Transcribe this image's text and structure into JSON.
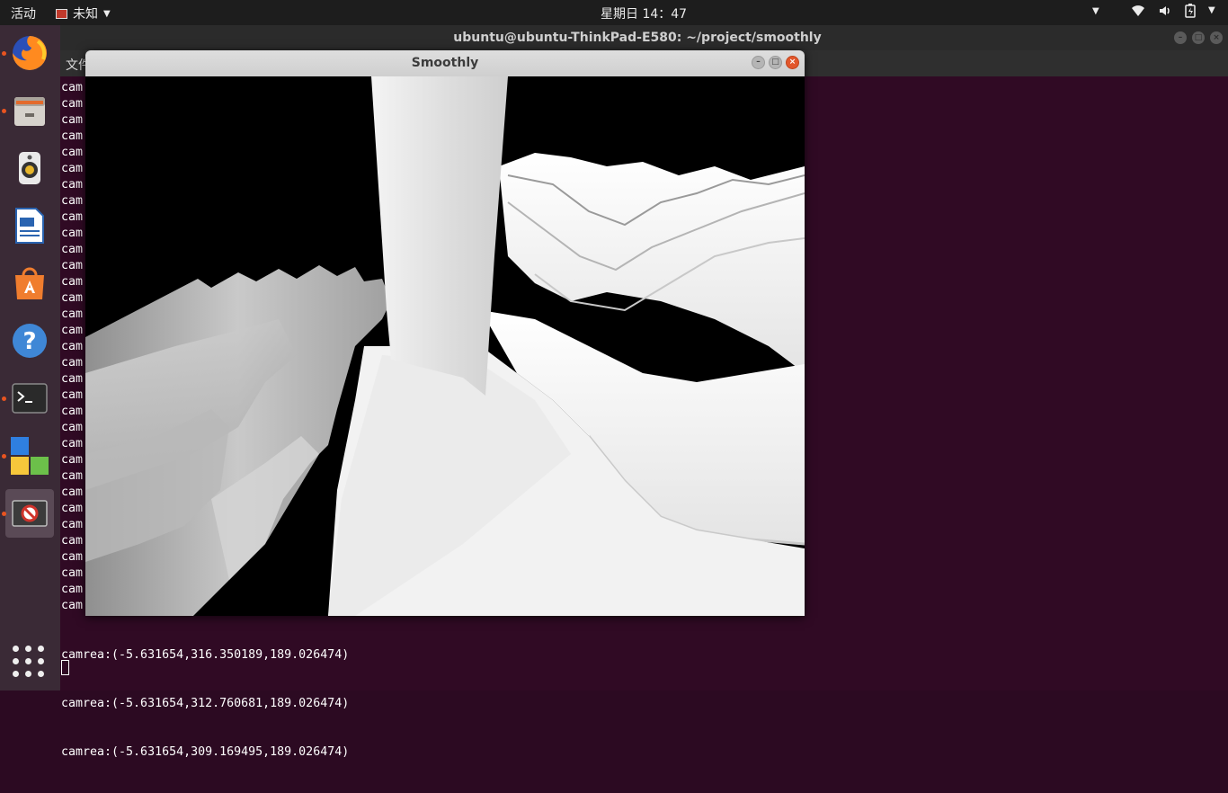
{
  "topbar": {
    "activities": "活动",
    "app_menu": "未知",
    "clock": "星期日 14：47",
    "tray_icons": [
      "wifi-icon",
      "volume-icon",
      "battery-icon",
      "chevron-down-icon"
    ]
  },
  "terminal": {
    "title": "ubuntu@ubuntu-ThinkPad-E580: ~/project/smoothly",
    "menu_first": "文件",
    "partial_prefix": "cam",
    "partial_line_count": 33,
    "lines": [
      "camrea:(-5.631654,316.350189,189.026474)",
      "camrea:(-5.631654,312.760681,189.026474)",
      "camrea:(-5.631654,309.169495,189.026474)"
    ]
  },
  "dock": {
    "items": [
      {
        "name": "firefox",
        "running": true
      },
      {
        "name": "files",
        "running": true
      },
      {
        "name": "rhythmbox",
        "running": false
      },
      {
        "name": "libreoffice-writer",
        "running": false
      },
      {
        "name": "ubuntu-software",
        "running": false
      },
      {
        "name": "help",
        "running": false
      },
      {
        "name": "terminal",
        "running": true
      },
      {
        "name": "app-blocks",
        "running": true
      },
      {
        "name": "unknown-app",
        "running": true,
        "active": true
      }
    ]
  },
  "smoothly": {
    "title": "Smoothly"
  }
}
